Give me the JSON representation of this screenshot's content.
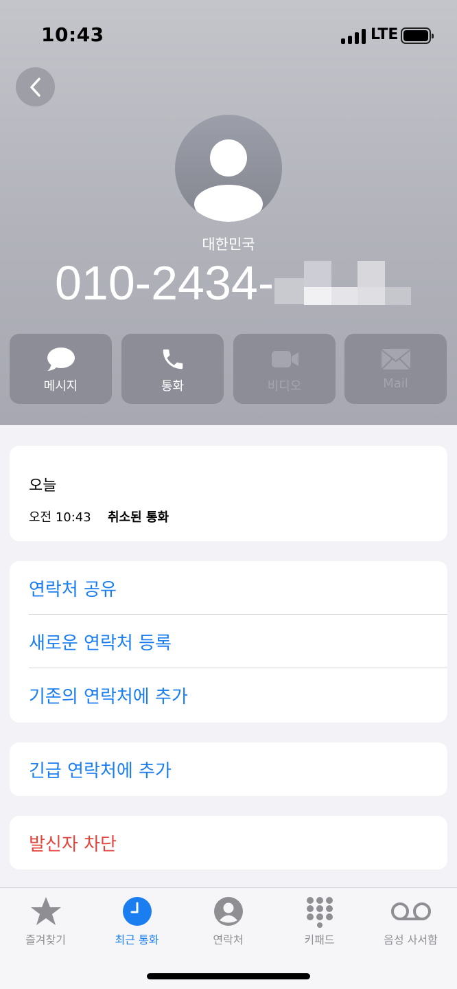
{
  "status_bar": {
    "time": "10:43",
    "network": "LTE"
  },
  "contact": {
    "region": "대한민국",
    "phone": "010-2434-"
  },
  "actions": [
    {
      "label": "메시지",
      "icon": "message-bubble-icon",
      "enabled": true
    },
    {
      "label": "통화",
      "icon": "phone-icon",
      "enabled": true
    },
    {
      "label": "비디오",
      "icon": "video-camera-icon",
      "enabled": false
    },
    {
      "label": "Mail",
      "icon": "mail-envelope-icon",
      "enabled": false
    }
  ],
  "call_log": {
    "day": "오늘",
    "time": "오전 10:43",
    "status": "취소된 통화"
  },
  "contact_options": {
    "share": "연락처 공유",
    "create_new": "새로운 연락처 등록",
    "add_existing": "기존의 연락처에 추가"
  },
  "emergency": {
    "add": "긴급 연락처에 추가"
  },
  "block": {
    "label": "발신자 차단"
  },
  "tabs": [
    {
      "label": "즐겨찾기",
      "icon": "star-icon",
      "active": false
    },
    {
      "label": "최근 통화",
      "icon": "clock-icon",
      "active": true
    },
    {
      "label": "연락처",
      "icon": "person-icon",
      "active": false
    },
    {
      "label": "키패드",
      "icon": "keypad-icon",
      "active": false
    },
    {
      "label": "음성 사서함",
      "icon": "voicemail-icon",
      "active": false
    }
  ],
  "colors": {
    "accent_blue": "#1a7ef0",
    "destructive_red": "#e5433b",
    "inactive_gray": "#8e8e93"
  }
}
